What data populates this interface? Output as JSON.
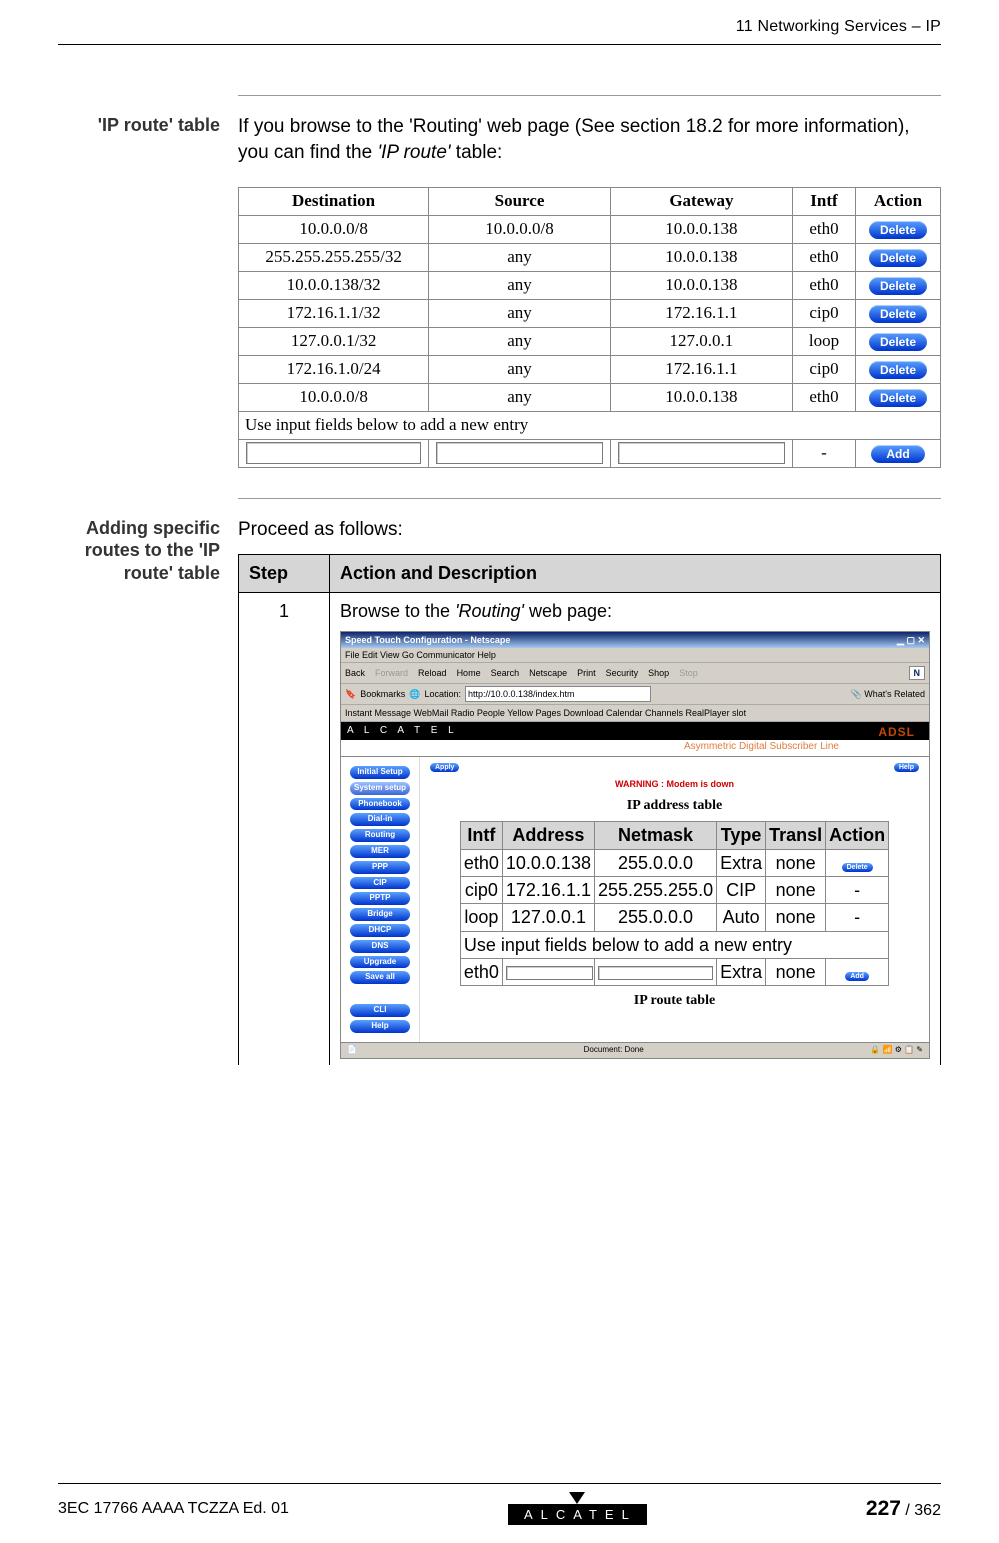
{
  "header": {
    "chapter": "11 Networking Services – IP"
  },
  "section1": {
    "label": "'IP route' table",
    "para_a": "If you browse to the 'Routing' web page (See section 18.2 for more information), you can find the ",
    "para_em": "'IP route'",
    "para_b": " table:"
  },
  "ipTable": {
    "headers": [
      "Destination",
      "Source",
      "Gateway",
      "Intf",
      "Action"
    ],
    "rows": [
      {
        "dest": "10.0.0.0/8",
        "src": "10.0.0.0/8",
        "gw": "10.0.0.138",
        "intf": "eth0",
        "action": "Delete"
      },
      {
        "dest": "255.255.255.255/32",
        "src": "any",
        "gw": "10.0.0.138",
        "intf": "eth0",
        "action": "Delete"
      },
      {
        "dest": "10.0.0.138/32",
        "src": "any",
        "gw": "10.0.0.138",
        "intf": "eth0",
        "action": "Delete"
      },
      {
        "dest": "172.16.1.1/32",
        "src": "any",
        "gw": "172.16.1.1",
        "intf": "cip0",
        "action": "Delete"
      },
      {
        "dest": "127.0.0.1/32",
        "src": "any",
        "gw": "127.0.0.1",
        "intf": "loop",
        "action": "Delete"
      },
      {
        "dest": "172.16.1.0/24",
        "src": "any",
        "gw": "172.16.1.1",
        "intf": "cip0",
        "action": "Delete"
      },
      {
        "dest": "10.0.0.0/8",
        "src": "any",
        "gw": "10.0.0.138",
        "intf": "eth0",
        "action": "Delete"
      }
    ],
    "hint": "Use input fields below to add a new entry",
    "addLabel": "Add",
    "dash": "-"
  },
  "section2": {
    "label": "Adding specific routes to the 'IP route' table",
    "para": "Proceed as follows:"
  },
  "steps": {
    "head_step": "Step",
    "head_action": "Action and Description",
    "r1_no": "1",
    "r1_a": "Browse to the ",
    "r1_em": "'Routing'",
    "r1_b": "  web page:"
  },
  "mock": {
    "title": "Speed Touch Configuration - Netscape",
    "menu": "File   Edit   View   Go   Communicator   Help",
    "toolbarItems": [
      "Back",
      "Forward",
      "Reload",
      "Home",
      "Search",
      "Netscape",
      "Print",
      "Security",
      "Shop",
      "Stop"
    ],
    "loc_label": "Bookmarks",
    "loc_prefix": "Location:",
    "loc_value": "http://10.0.0.138/index.htm",
    "related": "What's Related",
    "links": "Instant Message   WebMail   Radio   People   Yellow Pages   Download   Calendar   Channels   RealPlayer slot",
    "brand": "A L C A T E L",
    "adsl_sub": "Asymmetric Digital Subscriber Line",
    "adsl": "ADSL",
    "sidebar": [
      "Initial Setup",
      "System setup",
      "Phonebook",
      "Dial-in",
      "Routing",
      "MER",
      "PPP",
      "CIP",
      "PPTP",
      "Bridge",
      "DHCP",
      "DNS",
      "Upgrade",
      "Save all",
      "CLI",
      "Help"
    ],
    "apply": "Apply",
    "helpBtn": "Help",
    "warn": "WARNING : Modem is down",
    "t1": "IP address table",
    "t2": "IP route table",
    "mini_head": [
      "Intf",
      "Address",
      "Netmask",
      "Type",
      "Transl",
      "Action"
    ],
    "mini_rows": [
      {
        "intf": "eth0",
        "addr": "10.0.0.138",
        "mask": "255.0.0.0",
        "type": "Extra",
        "tr": "none",
        "act": "Delete"
      },
      {
        "intf": "cip0",
        "addr": "172.16.1.1",
        "mask": "255.255.255.0",
        "type": "CIP",
        "tr": "none",
        "act": "-"
      },
      {
        "intf": "loop",
        "addr": "127.0.0.1",
        "mask": "255.0.0.0",
        "type": "Auto",
        "tr": "none",
        "act": "-"
      }
    ],
    "mini_hint": "Use input fields below to add a new entry",
    "mini_add_intf": "eth0",
    "mini_add_type": "Extra",
    "mini_add_tr": "none",
    "mini_add": "Add",
    "status": "Document: Done"
  },
  "footer": {
    "doc": "3EC 17766 AAAA TCZZA Ed. 01",
    "logo": "ALCATEL",
    "page_cur": "227",
    "page_sep": " / ",
    "page_tot": "362"
  }
}
